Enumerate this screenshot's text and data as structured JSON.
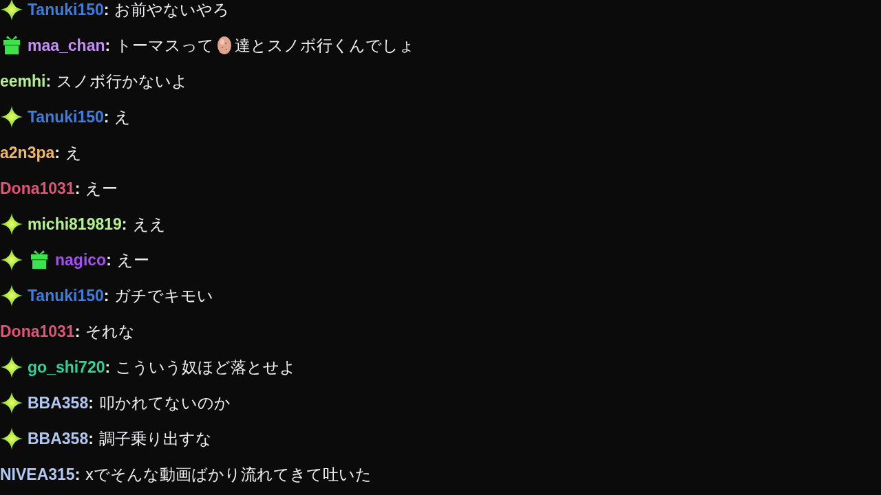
{
  "messages": [
    {
      "badges": [
        {
          "kind": "sparkle"
        }
      ],
      "user": "Tanuki150",
      "color": "#3b7de0",
      "separator": ":",
      "parts": [
        {
          "kind": "text",
          "text": "お前やないやろ"
        }
      ]
    },
    {
      "badges": [
        {
          "kind": "gift"
        }
      ],
      "user": "maa_chan",
      "color": "#c38ef5",
      "separator": ":",
      "parts": [
        {
          "kind": "text",
          "text": "トーマスって"
        },
        {
          "kind": "emote"
        },
        {
          "kind": "text",
          "text": "達とスノボ行くんでしょ"
        }
      ]
    },
    {
      "user": "eemhi",
      "color": "#b4f28e",
      "separator": ":",
      "parts": [
        {
          "kind": "text",
          "text": "スノボ行かないよ"
        }
      ]
    },
    {
      "badges": [
        {
          "kind": "sparkle"
        }
      ],
      "user": "Tanuki150",
      "color": "#3b7de0",
      "separator": ":",
      "parts": [
        {
          "kind": "text",
          "text": "え"
        }
      ]
    },
    {
      "user": "a2n3pa",
      "color": "#f2b764",
      "separator": ":",
      "parts": [
        {
          "kind": "text",
          "text": "え"
        }
      ]
    },
    {
      "user": "Dona1031",
      "color": "#e05577",
      "separator": ":",
      "parts": [
        {
          "kind": "text",
          "text": "えー"
        }
      ]
    },
    {
      "badges": [
        {
          "kind": "sparkle"
        }
      ],
      "user": "michi819819",
      "color": "#b4f28e",
      "separator": ":",
      "parts": [
        {
          "kind": "text",
          "text": "ええ"
        }
      ]
    },
    {
      "badges": [
        {
          "kind": "sparkle"
        },
        {
          "kind": "gift"
        }
      ],
      "user": "nagico",
      "color": "#a550f0",
      "separator": ":",
      "parts": [
        {
          "kind": "text",
          "text": "えー"
        }
      ]
    },
    {
      "badges": [
        {
          "kind": "sparkle"
        }
      ],
      "user": "Tanuki150",
      "color": "#3b7de0",
      "separator": ":",
      "parts": [
        {
          "kind": "text",
          "text": "ガチでキモい"
        }
      ]
    },
    {
      "user": "Dona1031",
      "color": "#e05577",
      "separator": ":",
      "parts": [
        {
          "kind": "text",
          "text": "それな"
        }
      ]
    },
    {
      "badges": [
        {
          "kind": "sparkle"
        }
      ],
      "user": "go_shi720",
      "color": "#2ed39c",
      "separator": ":",
      "parts": [
        {
          "kind": "text",
          "text": "こういう奴ほど落とせよ"
        }
      ]
    },
    {
      "badges": [
        {
          "kind": "sparkle"
        }
      ],
      "user": "BBA358",
      "color": "#b0c8f2",
      "separator": ":",
      "parts": [
        {
          "kind": "text",
          "text": "叩かれてないのか"
        }
      ]
    },
    {
      "badges": [
        {
          "kind": "sparkle"
        }
      ],
      "user": "BBA358",
      "color": "#b0c8f2",
      "separator": ":",
      "parts": [
        {
          "kind": "text",
          "text": "調子乗り出すな"
        }
      ]
    },
    {
      "user": "NIVEA315",
      "color": "#b0c8f2",
      "separator": ":",
      "parts": [
        {
          "kind": "text",
          "text": "xでそんな動画ばかり流れてきて吐いた"
        }
      ]
    }
  ]
}
